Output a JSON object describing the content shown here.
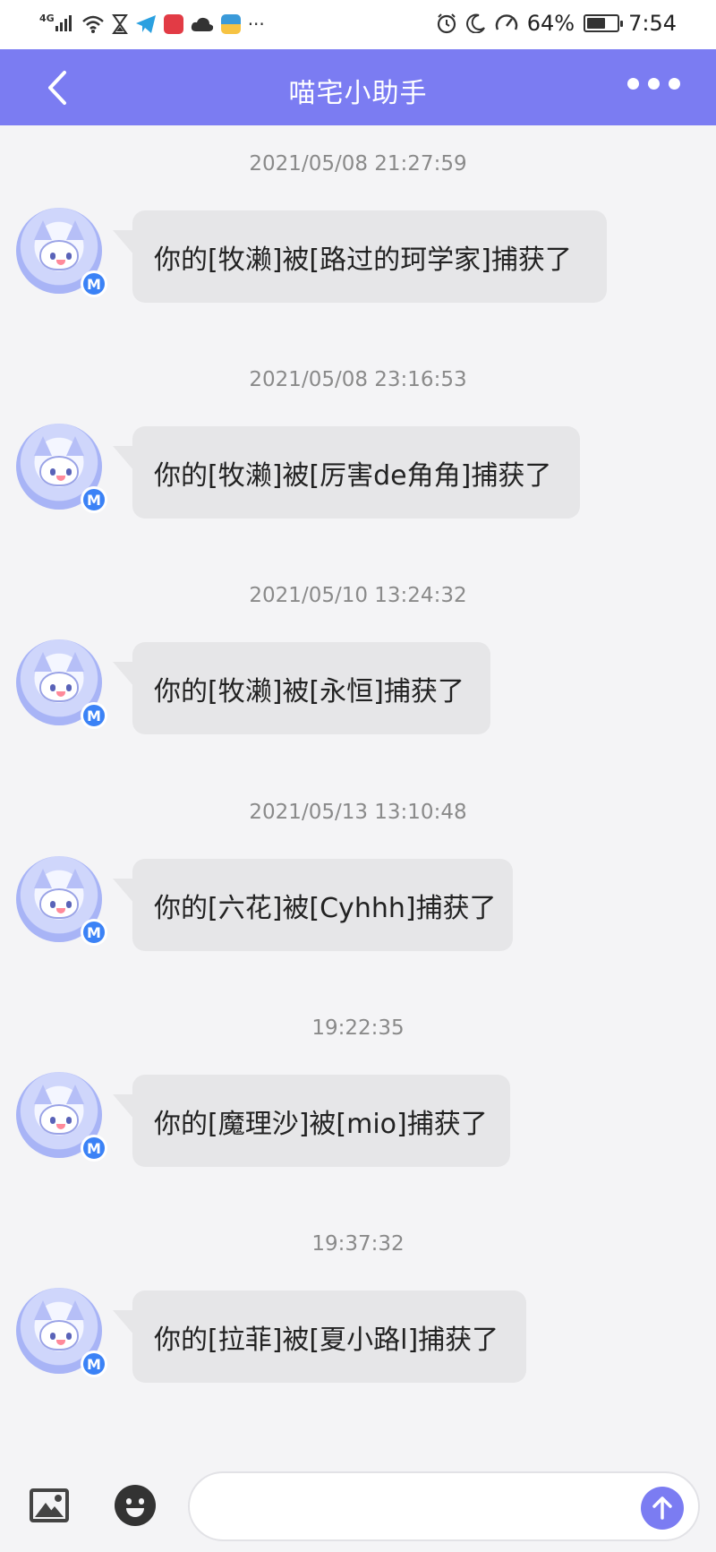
{
  "status_bar": {
    "network": "4G",
    "battery_percent": "64%",
    "battery_level": 0.64,
    "time": "7:54",
    "icons_left": [
      "signal-icon",
      "wifi-icon",
      "hourglass-icon",
      "telegram-icon",
      "app-red-icon",
      "cloud-icon",
      "app-wallet-icon",
      "more-dots-icon"
    ],
    "icons_right": [
      "alarm-icon",
      "moon-icon",
      "speed-icon",
      "battery-icon"
    ]
  },
  "header": {
    "title": "喵宅小助手",
    "back_icon": "chevron-left-icon",
    "more_icon": "more-dots-icon",
    "color": "#7b7cf2"
  },
  "messages": [
    {
      "timestamp": "2021/05/08 21:27:59",
      "text": "你的[牧濑]被[路过的珂学家]捕获了"
    },
    {
      "timestamp": "2021/05/08 23:16:53",
      "text": "你的[牧濑]被[厉害de角角]捕获了"
    },
    {
      "timestamp": "2021/05/10 13:24:32",
      "text": "你的[牧濑]被[永恒]捕获了"
    },
    {
      "timestamp": "2021/05/13 13:10:48",
      "text": "你的[六花]被[Cyhhh]捕获了"
    },
    {
      "timestamp": "19:22:35",
      "text": "你的[魔理沙]被[mio]捕获了"
    },
    {
      "timestamp": "19:37:32",
      "text": "你的[拉菲]被[夏小路l]捕获了"
    }
  ],
  "avatar_badge": "M",
  "input_bar": {
    "image_icon": "image-icon",
    "emoji_icon": "emoji-icon",
    "send_icon": "arrow-up-icon",
    "placeholder": ""
  }
}
